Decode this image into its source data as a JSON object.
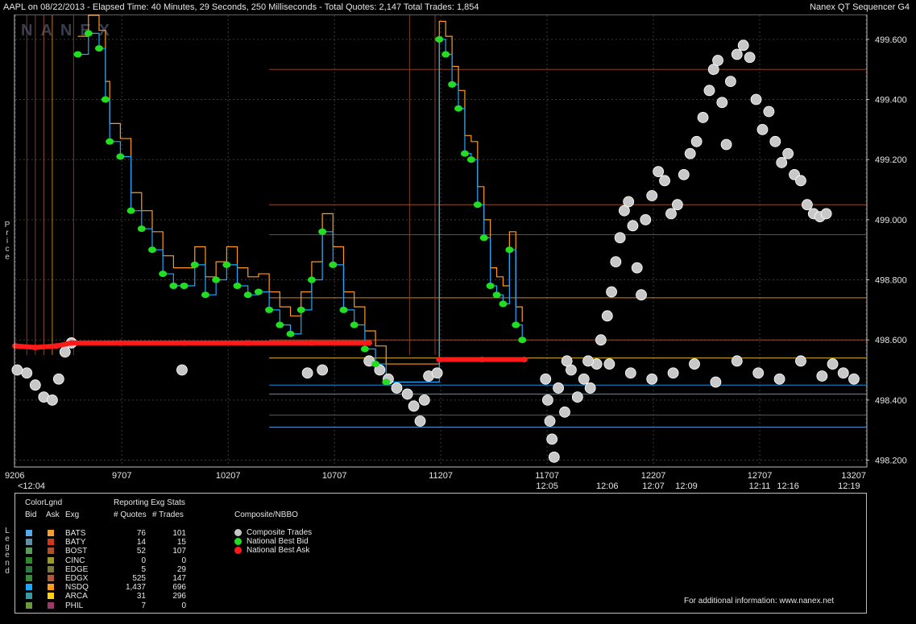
{
  "header": {
    "left": "AAPL on 08/22/2013  -  Elapsed Time: 40 Minutes, 29 Seconds, 250 Milliseconds  -  Total Quotes: 2,147  Total Trades: 1,854",
    "right": "Nanex QT Sequencer G4"
  },
  "watermark": "NANEX",
  "side_labels": {
    "price": "Price",
    "legend": "Legend"
  },
  "colors": {
    "trade": "#c8c8c8",
    "bid": "#22dd22",
    "ask": "#ff1a1a",
    "frame": "#bfbfbf",
    "background": "#000000"
  },
  "chart_data": {
    "type": "scatter",
    "title": "AAPL on 08/22/2013",
    "xlabel": "",
    "ylabel": "Price",
    "xlim": [
      9206,
      13207
    ],
    "ylim": [
      498.18,
      499.68
    ],
    "x_ticks": [
      "9206",
      "9707",
      "10207",
      "10707",
      "11207",
      "11707",
      "12207",
      "12707",
      "13207"
    ],
    "x_first_time_label": "<12:04",
    "time_labels": [
      {
        "seq": 11707,
        "time": "12:05"
      },
      {
        "seq": 11990,
        "time": "12:06"
      },
      {
        "seq": 12207,
        "time": "12:07"
      },
      {
        "seq": 12362,
        "time": "12:09"
      },
      {
        "seq": 12707,
        "time": "12:11"
      },
      {
        "seq": 12840,
        "time": "12:16"
      },
      {
        "seq": 13127,
        "time": "12:19"
      }
    ],
    "y_ticks": [
      "498.200",
      "498.400",
      "498.600",
      "498.800",
      "499.000",
      "499.200",
      "499.400",
      "499.600"
    ],
    "grid": true,
    "series": [
      {
        "name": "Composite Trades",
        "points": [
          [
            9215,
            498.5
          ],
          [
            9260,
            498.49
          ],
          [
            9300,
            498.45
          ],
          [
            9340,
            498.41
          ],
          [
            9380,
            498.4
          ],
          [
            9410,
            498.47
          ],
          [
            9440,
            498.56
          ],
          [
            9470,
            498.59
          ],
          [
            9990,
            498.5
          ],
          [
            10580,
            498.49
          ],
          [
            10650,
            498.5
          ],
          [
            10870,
            498.53
          ],
          [
            10920,
            498.5
          ],
          [
            10960,
            498.47
          ],
          [
            11000,
            498.44
          ],
          [
            11050,
            498.42
          ],
          [
            11080,
            498.38
          ],
          [
            11110,
            498.33
          ],
          [
            11130,
            498.4
          ],
          [
            11150,
            498.48
          ],
          [
            11190,
            498.49
          ],
          [
            11700,
            498.47
          ],
          [
            11710,
            498.4
          ],
          [
            11720,
            498.33
          ],
          [
            11730,
            498.27
          ],
          [
            11740,
            498.21
          ],
          [
            11760,
            498.44
          ],
          [
            11790,
            498.36
          ],
          [
            11820,
            498.5
          ],
          [
            11850,
            498.41
          ],
          [
            11880,
            498.47
          ],
          [
            11910,
            498.44
          ],
          [
            11940,
            498.52
          ],
          [
            11960,
            498.6
          ],
          [
            11990,
            498.68
          ],
          [
            12010,
            498.76
          ],
          [
            12030,
            498.86
          ],
          [
            12050,
            498.94
          ],
          [
            12070,
            499.03
          ],
          [
            12090,
            499.06
          ],
          [
            12110,
            498.98
          ],
          [
            12130,
            498.84
          ],
          [
            12150,
            498.75
          ],
          [
            12170,
            499.0
          ],
          [
            12200,
            499.08
          ],
          [
            12230,
            499.16
          ],
          [
            12260,
            499.13
          ],
          [
            12290,
            499.02
          ],
          [
            12320,
            499.05
          ],
          [
            12350,
            499.15
          ],
          [
            12380,
            499.22
          ],
          [
            12410,
            499.26
          ],
          [
            12440,
            499.34
          ],
          [
            12470,
            499.43
          ],
          [
            12490,
            499.5
          ],
          [
            12510,
            499.53
          ],
          [
            12530,
            499.39
          ],
          [
            12550,
            499.25
          ],
          [
            12570,
            499.46
          ],
          [
            12600,
            499.55
          ],
          [
            12630,
            499.58
          ],
          [
            12660,
            499.54
          ],
          [
            12690,
            499.4
          ],
          [
            12720,
            499.3
          ],
          [
            12750,
            499.36
          ],
          [
            12780,
            499.26
          ],
          [
            12810,
            499.19
          ],
          [
            12840,
            499.22
          ],
          [
            12870,
            499.15
          ],
          [
            12900,
            499.13
          ],
          [
            12930,
            499.05
          ],
          [
            12960,
            499.02
          ],
          [
            12990,
            499.01
          ],
          [
            13020,
            499.02
          ],
          [
            11800,
            498.53
          ],
          [
            11900,
            498.53
          ],
          [
            12000,
            498.52
          ],
          [
            12100,
            498.49
          ],
          [
            12200,
            498.47
          ],
          [
            12300,
            498.49
          ],
          [
            12400,
            498.52
          ],
          [
            12500,
            498.46
          ],
          [
            12600,
            498.53
          ],
          [
            12700,
            498.49
          ],
          [
            12800,
            498.47
          ],
          [
            12900,
            498.53
          ],
          [
            13000,
            498.48
          ],
          [
            13050,
            498.52
          ],
          [
            13100,
            498.49
          ],
          [
            13150,
            498.47
          ]
        ]
      },
      {
        "name": "National Best Bid",
        "points": [
          [
            9500,
            499.55
          ],
          [
            9550,
            499.62
          ],
          [
            9600,
            499.57
          ],
          [
            9630,
            499.4
          ],
          [
            9650,
            499.26
          ],
          [
            9700,
            499.21
          ],
          [
            9750,
            499.03
          ],
          [
            9800,
            498.97
          ],
          [
            9850,
            498.9
          ],
          [
            9900,
            498.82
          ],
          [
            9950,
            498.78
          ],
          [
            10000,
            498.78
          ],
          [
            10050,
            498.85
          ],
          [
            10100,
            498.75
          ],
          [
            10150,
            498.8
          ],
          [
            10200,
            498.85
          ],
          [
            10250,
            498.78
          ],
          [
            10300,
            498.75
          ],
          [
            10350,
            498.76
          ],
          [
            10400,
            498.7
          ],
          [
            10450,
            498.65
          ],
          [
            10500,
            498.62
          ],
          [
            10550,
            498.7
          ],
          [
            10600,
            498.8
          ],
          [
            10650,
            498.96
          ],
          [
            10700,
            498.85
          ],
          [
            10750,
            498.7
          ],
          [
            10800,
            498.65
          ],
          [
            10850,
            498.57
          ],
          [
            10900,
            498.52
          ],
          [
            10950,
            498.46
          ],
          [
            11200,
            499.6
          ],
          [
            11230,
            499.55
          ],
          [
            11260,
            499.45
          ],
          [
            11290,
            499.37
          ],
          [
            11320,
            499.22
          ],
          [
            11350,
            499.2
          ],
          [
            11380,
            499.05
          ],
          [
            11410,
            498.94
          ],
          [
            11440,
            498.78
          ],
          [
            11470,
            498.75
          ],
          [
            11500,
            498.72
          ],
          [
            11530,
            498.9
          ],
          [
            11560,
            498.65
          ],
          [
            11590,
            498.6
          ]
        ]
      },
      {
        "name": "National Best Ask",
        "points": [
          [
            9206,
            498.58
          ],
          [
            9300,
            498.575
          ],
          [
            9400,
            498.58
          ],
          [
            9470,
            498.59
          ],
          [
            9700,
            498.59
          ],
          [
            10000,
            498.59
          ],
          [
            10300,
            498.59
          ],
          [
            10600,
            498.59
          ],
          [
            10870,
            498.59
          ],
          [
            11200,
            498.535
          ],
          [
            11400,
            498.535
          ],
          [
            11600,
            498.535
          ]
        ]
      }
    ]
  },
  "legend": {
    "colorlgnd": "ColorLgnd",
    "col_bid": "Bid",
    "col_ask": "Ask",
    "col_exg": "Exg",
    "stats_title": "Reporting Exg Stats",
    "col_quotes": "# Quotes",
    "col_trades": "# Trades",
    "composite_title": "Composite/NBBO",
    "composite_items": [
      {
        "label": "Composite Trades",
        "color": "#c8c8c8"
      },
      {
        "label": "National Best Bid",
        "color": "#22dd22"
      },
      {
        "label": "National Best Ask",
        "color": "#ff1a1a"
      }
    ],
    "exchanges": [
      {
        "name": "BATS",
        "quotes": "76",
        "trades": "101",
        "bid_color": "#55aaee",
        "ask_color": "#f0a030"
      },
      {
        "name": "BATY",
        "quotes": "14",
        "trades": "15",
        "bid_color": "#5f8fa8",
        "ask_color": "#cc3a1a"
      },
      {
        "name": "BOST",
        "quotes": "52",
        "trades": "107",
        "bid_color": "#5a9a5a",
        "ask_color": "#b0502a"
      },
      {
        "name": "CINC",
        "quotes": "0",
        "trades": "0",
        "bid_color": "#2f8a2f",
        "ask_color": "#9a9a2a"
      },
      {
        "name": "EDGE",
        "quotes": "5",
        "trades": "29",
        "bid_color": "#2f7a3f",
        "ask_color": "#7a7a3a"
      },
      {
        "name": "EDGX",
        "quotes": "525",
        "trades": "147",
        "bid_color": "#3a8a3a",
        "ask_color": "#b05a3a"
      },
      {
        "name": "NSDQ",
        "quotes": "1,437",
        "trades": "696",
        "bid_color": "#1ea8ff",
        "ask_color": "#ff9a1a"
      },
      {
        "name": "ARCA",
        "quotes": "31",
        "trades": "296",
        "bid_color": "#3a9aa0",
        "ask_color": "#ffd21a"
      },
      {
        "name": "PHIL",
        "quotes": "7",
        "trades": "0",
        "bid_color": "#6a9a3a",
        "ask_color": "#9a3a6a"
      }
    ],
    "footer": "For additional information: www.nanex.net"
  }
}
